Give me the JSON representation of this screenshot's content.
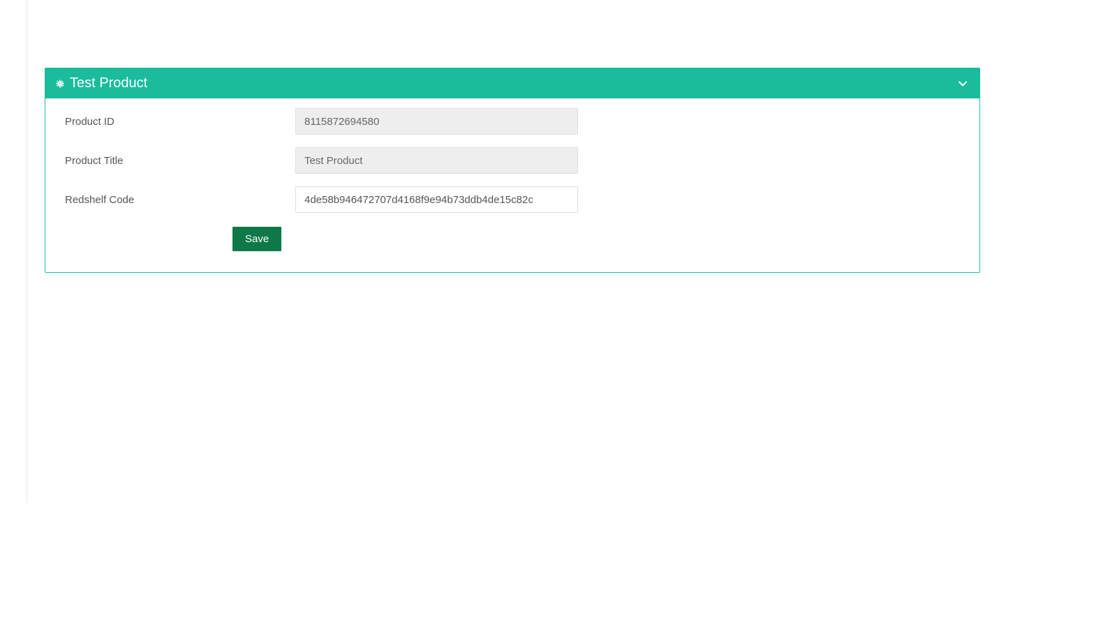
{
  "panel": {
    "title": "Test Product",
    "fields": {
      "product_id": {
        "label": "Product ID",
        "value": "8115872694580"
      },
      "product_title": {
        "label": "Product Title",
        "value": "Test Product"
      },
      "redshelf_code": {
        "label": "Redshelf Code",
        "value": "4de58b946472707d4168f9e94b73ddb4de15c82c"
      }
    },
    "save_label": "Save"
  }
}
